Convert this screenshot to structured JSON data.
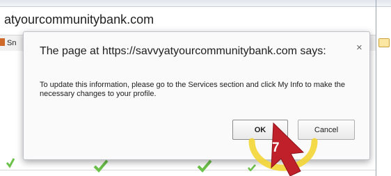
{
  "browser": {
    "address_text": "atyourcommunitybank.com",
    "bookmark_label": "Sn"
  },
  "dialog": {
    "title": "The page at https://savvyatyourcommunitybank.com says:",
    "close_glyph": "×",
    "message": "To update this information, please go to the Services section and click My Info to make the necessary changes to your profile.",
    "ok_label": "OK",
    "cancel_label": "Cancel"
  },
  "callout": {
    "step_number": "7",
    "arrow_color": "#c0202a",
    "highlight_color": "#f3d534"
  },
  "background_icons": [
    "check-icon",
    "check-icon",
    "check-icon",
    "check-icon"
  ]
}
